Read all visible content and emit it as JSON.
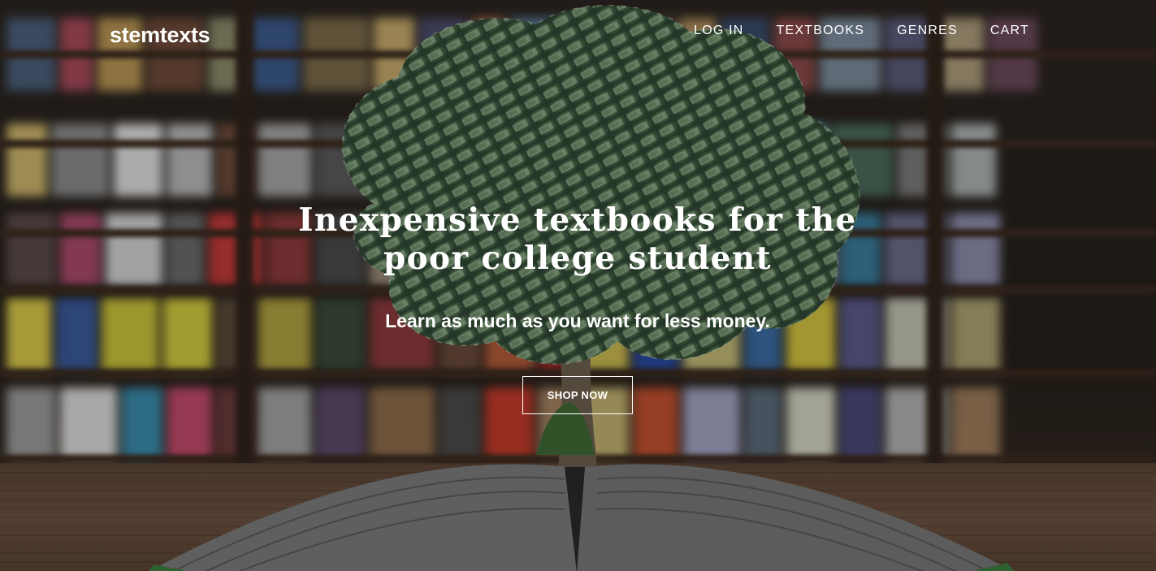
{
  "brand": {
    "name": "stemtexts"
  },
  "nav": {
    "items": [
      {
        "label": "LOG IN"
      },
      {
        "label": "TEXTBOOKS"
      },
      {
        "label": "GENRES"
      },
      {
        "label": "CART"
      }
    ]
  },
  "hero": {
    "headline_line1": "Inexpensive textbooks for the",
    "headline_line2": "poor college student",
    "subheadline": "Learn as much as you want for less money.",
    "cta_label": "SHOP NOW",
    "background_image": "money-tree-growing-from-open-book-in-library"
  },
  "colors": {
    "text": "#ffffff",
    "cta_border": "#ffffff"
  }
}
